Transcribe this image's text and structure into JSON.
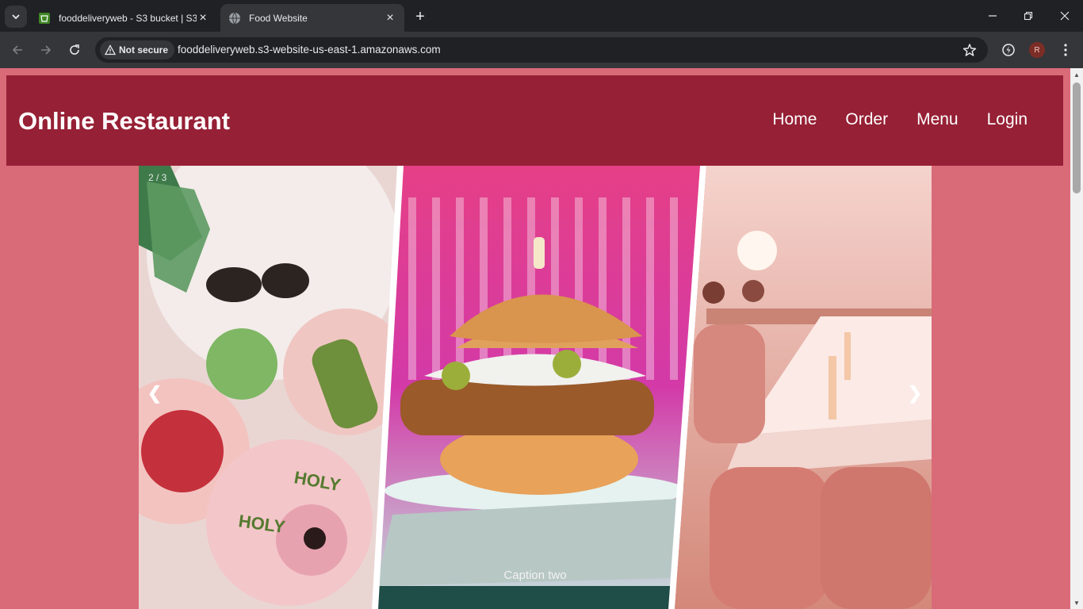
{
  "browser": {
    "tabs": [
      {
        "title": "fooddeliveryweb - S3 bucket | S3",
        "favicon": "s3-bucket-icon",
        "active": false
      },
      {
        "title": "Food Website",
        "favicon": "globe-icon",
        "active": true
      }
    ],
    "security_label": "Not secure",
    "url": "fooddeliveryweb.s3-website-us-east-1.amazonaws.com",
    "profile_initial": "R"
  },
  "site": {
    "brand": "Online Restaurant",
    "nav": [
      "Home",
      "Order",
      "Menu",
      "Login"
    ],
    "background_color": "#d96a78",
    "header_color": "#962035"
  },
  "slideshow": {
    "counter": "2 / 3",
    "caption": "Caption two",
    "prev_symbol": "❮",
    "next_symbol": "❯"
  }
}
